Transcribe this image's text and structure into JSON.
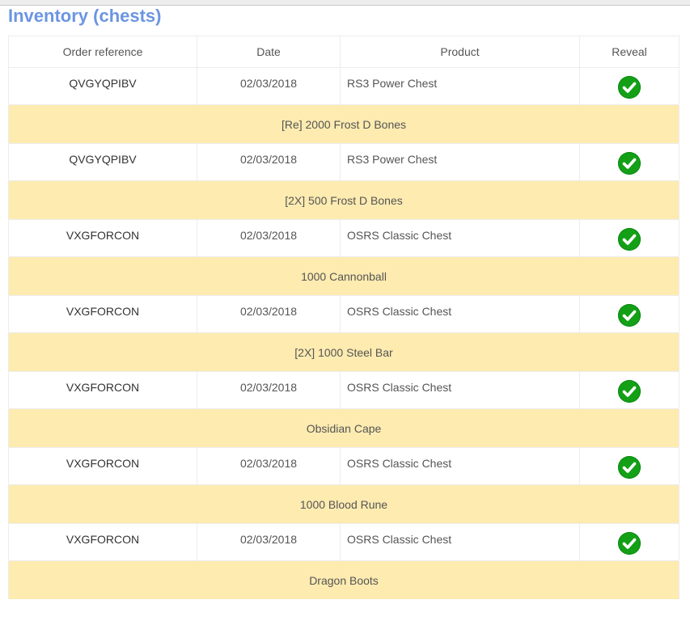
{
  "page": {
    "title": "Inventory (chests)"
  },
  "table": {
    "headers": [
      "Order reference",
      "Date",
      "Product",
      "Reveal"
    ],
    "rows": [
      {
        "ref": "QVGYQPIBV",
        "date": "02/03/2018",
        "product": "RS3 Power Chest",
        "reveal_icon": "check-circle-icon",
        "detail": "[Re] 2000 Frost D Bones"
      },
      {
        "ref": "QVGYQPIBV",
        "date": "02/03/2018",
        "product": "RS3 Power Chest",
        "reveal_icon": "check-circle-icon",
        "detail": "[2X] 500 Frost D Bones"
      },
      {
        "ref": "VXGFORCON",
        "date": "02/03/2018",
        "product": "OSRS Classic Chest",
        "reveal_icon": "check-circle-icon",
        "detail": "1000 Cannonball"
      },
      {
        "ref": "VXGFORCON",
        "date": "02/03/2018",
        "product": "OSRS Classic Chest",
        "reveal_icon": "check-circle-icon",
        "detail": "[2X] 1000 Steel Bar"
      },
      {
        "ref": "VXGFORCON",
        "date": "02/03/2018",
        "product": "OSRS Classic Chest",
        "reveal_icon": "check-circle-icon",
        "detail": "Obsidian Cape"
      },
      {
        "ref": "VXGFORCON",
        "date": "02/03/2018",
        "product": "OSRS Classic Chest",
        "reveal_icon": "check-circle-icon",
        "detail": "1000 Blood Rune"
      },
      {
        "ref": "VXGFORCON",
        "date": "02/03/2018",
        "product": "OSRS Classic Chest",
        "reveal_icon": "check-circle-icon",
        "detail": "Dragon Boots"
      }
    ]
  },
  "colors": {
    "title": "#6b95e2",
    "detail_bg": "#fdebb0",
    "check": "#13a017"
  }
}
